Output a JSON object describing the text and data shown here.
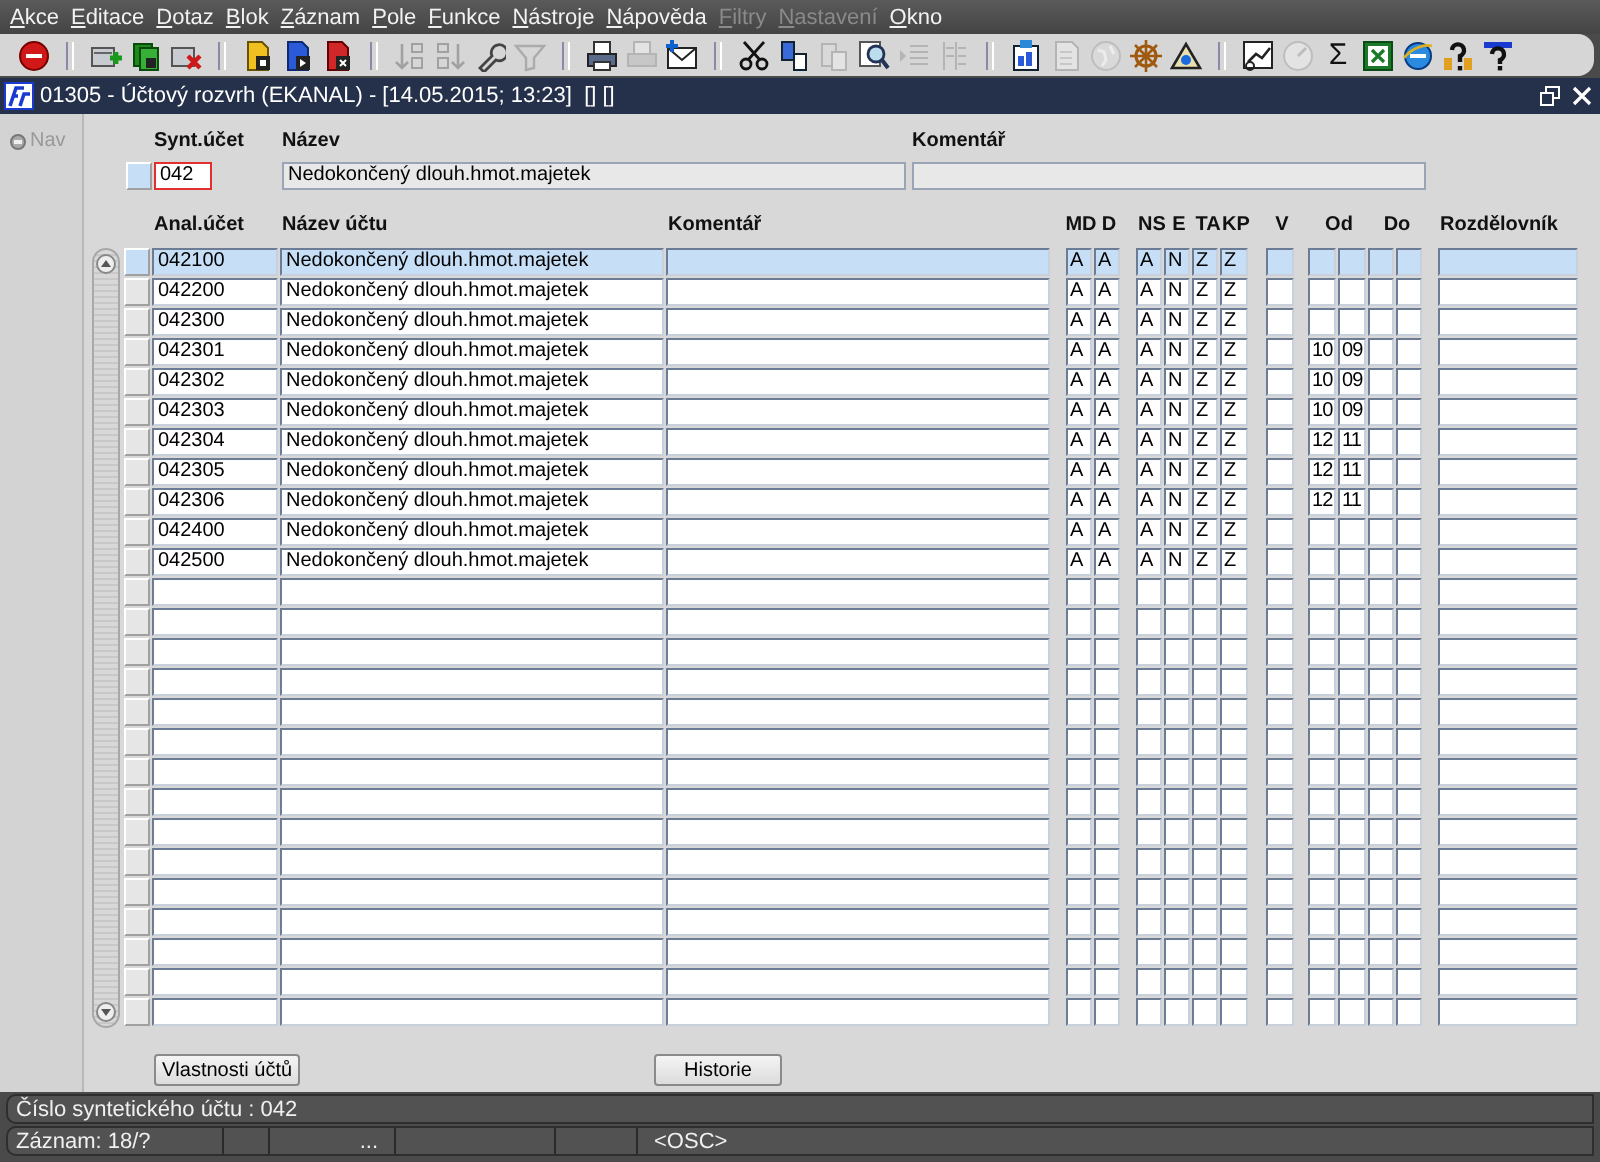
{
  "menu": [
    {
      "label": "Akce",
      "disabled": false
    },
    {
      "label": "Editace",
      "disabled": false
    },
    {
      "label": "Dotaz",
      "disabled": false
    },
    {
      "label": "Blok",
      "disabled": false
    },
    {
      "label": "Záznam",
      "disabled": false
    },
    {
      "label": "Pole",
      "disabled": false
    },
    {
      "label": "Funkce",
      "disabled": false
    },
    {
      "label": "Nástroje",
      "disabled": false
    },
    {
      "label": "Nápověda",
      "disabled": false
    },
    {
      "label": "Filtry",
      "disabled": true
    },
    {
      "label": "Nastavení",
      "disabled": true
    },
    {
      "label": "Okno",
      "disabled": false
    }
  ],
  "toolbar": [
    {
      "kind": "button",
      "disabled": false
    },
    {
      "kind": "separator"
    },
    {
      "kind": "button",
      "disabled": false
    },
    {
      "kind": "button",
      "disabled": false
    },
    {
      "kind": "button",
      "disabled": false
    },
    {
      "kind": "separator"
    },
    {
      "kind": "button",
      "disabled": false
    },
    {
      "kind": "button",
      "disabled": false
    },
    {
      "kind": "button",
      "disabled": false
    },
    {
      "kind": "separator"
    },
    {
      "kind": "button",
      "disabled": true
    },
    {
      "kind": "button",
      "disabled": true
    },
    {
      "kind": "button",
      "disabled": false
    },
    {
      "kind": "button",
      "disabled": true
    },
    {
      "kind": "separator"
    },
    {
      "kind": "button",
      "disabled": false
    },
    {
      "kind": "button",
      "disabled": true
    },
    {
      "kind": "button",
      "disabled": false
    },
    {
      "kind": "separator"
    },
    {
      "kind": "button",
      "disabled": false
    },
    {
      "kind": "button",
      "disabled": false
    },
    {
      "kind": "button",
      "disabled": true
    },
    {
      "kind": "button",
      "disabled": false
    },
    {
      "kind": "button",
      "disabled": true
    },
    {
      "kind": "button",
      "disabled": true
    },
    {
      "kind": "separator"
    },
    {
      "kind": "button",
      "disabled": false
    },
    {
      "kind": "button",
      "disabled": true
    },
    {
      "kind": "button",
      "disabled": true
    },
    {
      "kind": "button",
      "disabled": false
    },
    {
      "kind": "button",
      "disabled": false
    },
    {
      "kind": "separator"
    },
    {
      "kind": "button",
      "disabled": false
    },
    {
      "kind": "button",
      "disabled": true
    },
    {
      "kind": "text",
      "label": "Σ",
      "disabled": false
    },
    {
      "kind": "button",
      "disabled": false
    },
    {
      "kind": "button",
      "disabled": false
    },
    {
      "kind": "button",
      "disabled": false
    },
    {
      "kind": "button",
      "disabled": false
    }
  ],
  "window": {
    "title": "01305 - Účtový rozvrh (EKANAL) - [14.05.2015; 13:23]  [] []"
  },
  "nav": {
    "label": "Nav",
    "disabled": true
  },
  "header": {
    "columns": [
      "Synt.účet",
      "Název",
      "Komentář"
    ],
    "synt_ucet": "042",
    "nazev": "Nedokončený dlouh.hmot.majetek"
  },
  "table": {
    "columns": [
      "Anal.účet",
      "Název účtu",
      "Komentář",
      "MD",
      "D",
      "NS",
      "E",
      "TA",
      "KP",
      "V",
      "Od",
      "Do",
      "Rozdělovník"
    ],
    "rows": [
      {
        "selected": true,
        "anal_ucet": "042100",
        "nazev_uctu": "Nedokončený dlouh.hmot.majetek",
        "md": "A",
        "d": "A",
        "ns": "A",
        "e": "N",
        "ta": "Z",
        "kp": "Z"
      },
      {
        "selected": false,
        "anal_ucet": "042200",
        "nazev_uctu": "Nedokončený dlouh.hmot.majetek",
        "md": "A",
        "d": "A",
        "ns": "A",
        "e": "N",
        "ta": "Z",
        "kp": "Z"
      },
      {
        "selected": false,
        "anal_ucet": "042300",
        "nazev_uctu": "Nedokončený dlouh.hmot.majetek",
        "md": "A",
        "d": "A",
        "ns": "A",
        "e": "N",
        "ta": "Z",
        "kp": "Z"
      },
      {
        "selected": false,
        "anal_ucet": "042301",
        "nazev_uctu": "Nedokončený dlouh.hmot.majetek",
        "md": "A",
        "d": "A",
        "ns": "A",
        "e": "N",
        "ta": "Z",
        "kp": "Z",
        "od_1": "10",
        "od_2": "09"
      },
      {
        "selected": false,
        "anal_ucet": "042302",
        "nazev_uctu": "Nedokončený dlouh.hmot.majetek",
        "md": "A",
        "d": "A",
        "ns": "A",
        "e": "N",
        "ta": "Z",
        "kp": "Z",
        "od_1": "10",
        "od_2": "09"
      },
      {
        "selected": false,
        "anal_ucet": "042303",
        "nazev_uctu": "Nedokončený dlouh.hmot.majetek",
        "md": "A",
        "d": "A",
        "ns": "A",
        "e": "N",
        "ta": "Z",
        "kp": "Z",
        "od_1": "10",
        "od_2": "09"
      },
      {
        "selected": false,
        "anal_ucet": "042304",
        "nazev_uctu": "Nedokončený dlouh.hmot.majetek",
        "md": "A",
        "d": "A",
        "ns": "A",
        "e": "N",
        "ta": "Z",
        "kp": "Z",
        "od_1": "12",
        "od_2": "11"
      },
      {
        "selected": false,
        "anal_ucet": "042305",
        "nazev_uctu": "Nedokončený dlouh.hmot.majetek",
        "md": "A",
        "d": "A",
        "ns": "A",
        "e": "N",
        "ta": "Z",
        "kp": "Z",
        "od_1": "12",
        "od_2": "11"
      },
      {
        "selected": false,
        "anal_ucet": "042306",
        "nazev_uctu": "Nedokončený dlouh.hmot.majetek",
        "md": "A",
        "d": "A",
        "ns": "A",
        "e": "N",
        "ta": "Z",
        "kp": "Z",
        "od_1": "12",
        "od_2": "11"
      },
      {
        "selected": false,
        "anal_ucet": "042400",
        "nazev_uctu": "Nedokončený dlouh.hmot.majetek",
        "md": "A",
        "d": "A",
        "ns": "A",
        "e": "N",
        "ta": "Z",
        "kp": "Z"
      },
      {
        "selected": false,
        "anal_ucet": "042500",
        "nazev_uctu": "Nedokončený dlouh.hmot.majetek",
        "md": "A",
        "d": "A",
        "ns": "A",
        "e": "N",
        "ta": "Z",
        "kp": "Z"
      },
      {
        "selected": false
      },
      {
        "selected": false
      },
      {
        "selected": false
      },
      {
        "selected": false
      },
      {
        "selected": false
      },
      {
        "selected": false
      },
      {
        "selected": false
      },
      {
        "selected": false
      },
      {
        "selected": false
      },
      {
        "selected": false
      },
      {
        "selected": false
      },
      {
        "selected": false
      },
      {
        "selected": false
      },
      {
        "selected": false
      },
      {
        "selected": false
      }
    ]
  },
  "buttons": [
    "Vlastnosti účtů",
    "Historie"
  ],
  "status_bar": {
    "message": "Číslo syntetického účtu : 042",
    "record": "Záznam: 18/?",
    "field_3": "...",
    "mode": "<OSC>"
  }
}
